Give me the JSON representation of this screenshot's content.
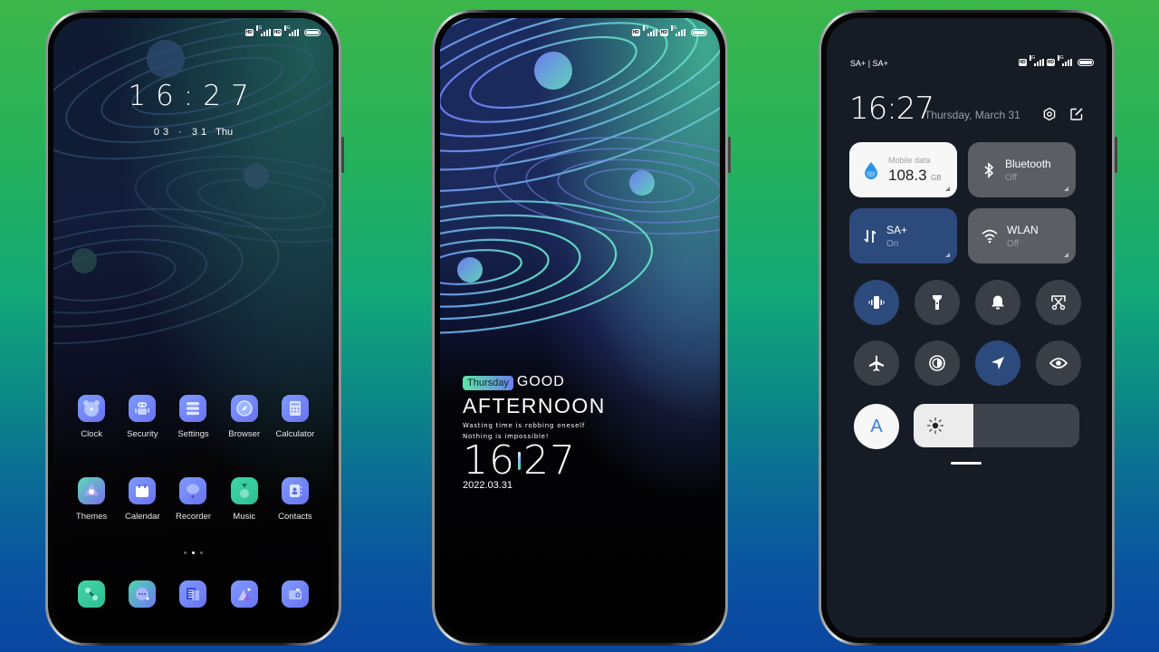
{
  "status_bar": {
    "hd": "HD",
    "network": "4G"
  },
  "home_screen": {
    "clock": "16:27",
    "date": "03 · 31",
    "weekday": "Thu",
    "apps_row1": [
      {
        "label": "Clock",
        "icon": "clock-icon"
      },
      {
        "label": "Security",
        "icon": "robot-icon"
      },
      {
        "label": "Settings",
        "icon": "settings-icon"
      },
      {
        "label": "Browser",
        "icon": "compass-icon"
      },
      {
        "label": "Calculator",
        "icon": "calculator-icon"
      }
    ],
    "apps_row2": [
      {
        "label": "Themes",
        "icon": "themes-icon"
      },
      {
        "label": "Calendar",
        "icon": "calendar-icon"
      },
      {
        "label": "Recorder",
        "icon": "recorder-icon"
      },
      {
        "label": "Music",
        "icon": "music-icon"
      },
      {
        "label": "Contacts",
        "icon": "contacts-icon"
      }
    ],
    "page_indicator": {
      "pages": 3,
      "current": 2
    },
    "dock": [
      {
        "icon": "phone-icon"
      },
      {
        "icon": "messages-icon"
      },
      {
        "icon": "notes-icon"
      },
      {
        "icon": "gallery-icon"
      },
      {
        "icon": "camera-icon"
      }
    ]
  },
  "lock_screen": {
    "weekday_badge": "Thursday",
    "greeting_1": "GOOD",
    "greeting_2": "AFTERNOON",
    "quote_1": "Wasting time is robbing oneself",
    "quote_2": "Nothing is impossible!",
    "time_hours": "16",
    "time_minutes": "27",
    "date": "2022.03.31"
  },
  "control_center": {
    "carrier": "SA+ | SA+",
    "time": "16:27",
    "date": "Thursday, March 31",
    "tiles": {
      "mobile_data": {
        "label": "Mobile data",
        "value": "108.3",
        "unit": "GB"
      },
      "bluetooth": {
        "title": "Bluetooth",
        "state": "Off"
      },
      "sa": {
        "title": "SA+",
        "state": "On"
      },
      "wlan": {
        "title": "WLAN",
        "state": "Off"
      }
    },
    "toggles": [
      {
        "name": "vibrate",
        "active": true
      },
      {
        "name": "flashlight",
        "active": false
      },
      {
        "name": "ring",
        "active": false
      },
      {
        "name": "screenshot",
        "active": false
      },
      {
        "name": "airplane-mode",
        "active": false
      },
      {
        "name": "dark-mode",
        "active": false
      },
      {
        "name": "location",
        "active": true
      },
      {
        "name": "reading-mode",
        "active": false
      }
    ],
    "auto_brightness_label": "A",
    "brightness_percent": 36
  },
  "colors": {
    "accent_blue": "#2d4a7c",
    "tile_grey": "#5b5e63",
    "panel_bg": "#161c25",
    "auto_blue": "#3d7dea"
  }
}
